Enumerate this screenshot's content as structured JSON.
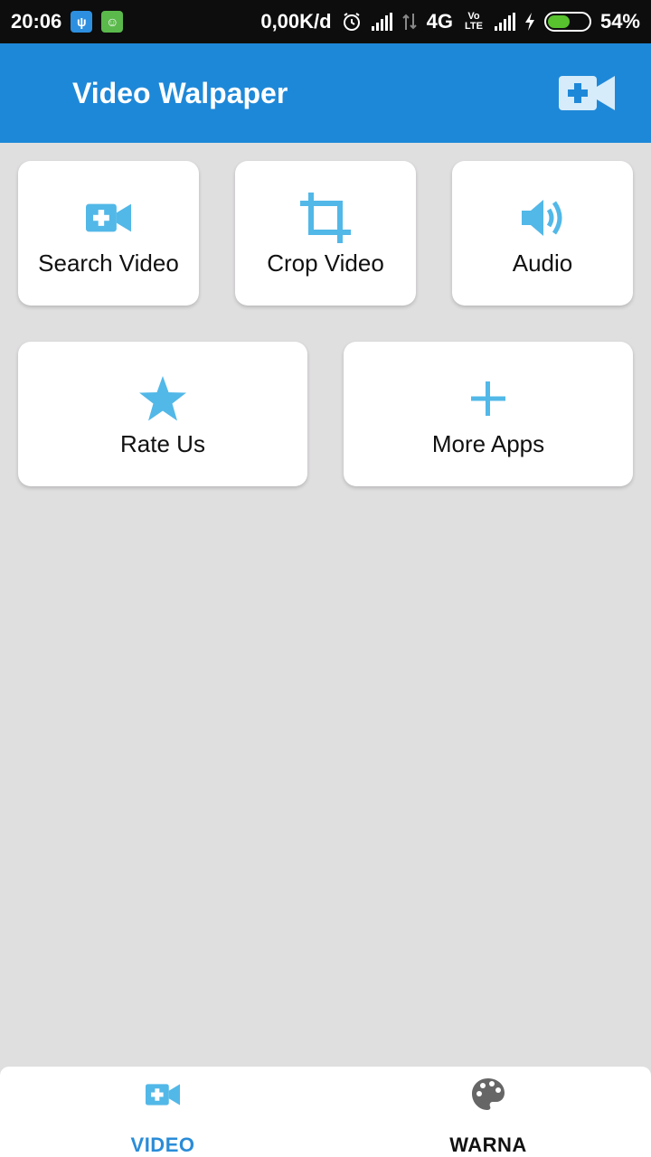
{
  "status_bar": {
    "time": "20:06",
    "speed": "0,00K/d",
    "network": "4G",
    "volte": "Vo LTE",
    "battery": "54%",
    "battery_level": 0.54
  },
  "app_bar": {
    "title": "Video Walpaper",
    "action_icon": "add-video-icon"
  },
  "menu": [
    {
      "label": "Search Video",
      "icon": "video-camera-plus-icon"
    },
    {
      "label": "Crop Video",
      "icon": "crop-icon"
    },
    {
      "label": "Audio",
      "icon": "volume-icon"
    },
    {
      "label": "Rate Us",
      "icon": "star-icon"
    },
    {
      "label": "More Apps",
      "icon": "plus-icon"
    }
  ],
  "bottom_nav": {
    "tabs": [
      {
        "label": "VIDEO",
        "icon": "video-camera-plus-icon",
        "active": true
      },
      {
        "label": "WARNA",
        "icon": "palette-icon",
        "active": false
      }
    ]
  },
  "colors": {
    "primary": "#1e88d8",
    "accent": "#52b8e8",
    "background": "#e0dfe0",
    "active_tab": "#2a8cd8"
  }
}
